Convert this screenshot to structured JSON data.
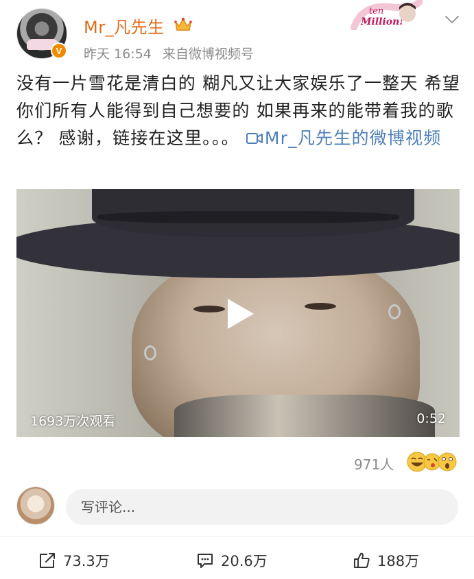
{
  "post": {
    "username": "Mr_凡先生",
    "time": "昨天 16:54",
    "source": "来自微博视频号",
    "text": "没有一片雪花是清白的 糊凡又让大家娱乐了一整天 希望你们所有人能得到自己想要的 如果再来的能带着我的歌么？ 感谢，链接在这里。。。 ",
    "video_link_text": "Mr_凡先生的微博视频"
  },
  "badge": {
    "text_line1": "ten",
    "text_line2": "Million!"
  },
  "video": {
    "view_count": "1693万次观看",
    "duration": "0:52"
  },
  "reactions": {
    "count": "971人"
  },
  "comment": {
    "placeholder": "写评论..."
  },
  "actions": {
    "repost": "73.3万",
    "comment": "20.6万",
    "like": "188万"
  },
  "colors": {
    "username": "#e06b18",
    "link": "#4e7fb8",
    "meta": "#8a8a8a",
    "verify": "#f08a00"
  },
  "icons": {
    "verify": "verified-v-icon",
    "crown": "crown-icon",
    "chevron": "chevron-down-icon",
    "play": "play-icon",
    "repost": "repost-icon",
    "comment": "comment-icon",
    "like": "thumbs-up-icon"
  }
}
